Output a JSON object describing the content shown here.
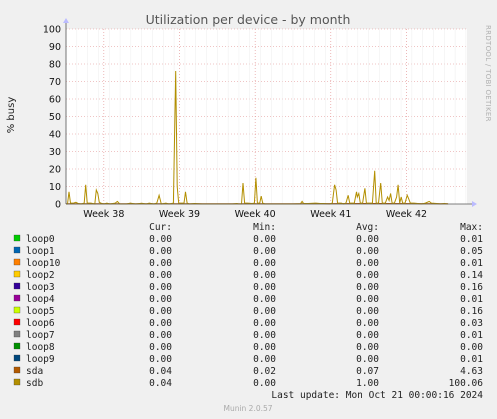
{
  "side_label": "RRDTOOL / TOBI OETIKER",
  "legend_headers": [
    "Cur:",
    "Min:",
    "Avg:",
    "Max:"
  ],
  "legend": [
    {
      "name": "loop0",
      "color": "#00cc00",
      "cur": "0.00",
      "min": "0.00",
      "avg": "0.00",
      "max": "0.01"
    },
    {
      "name": "loop1",
      "color": "#0066b3",
      "cur": "0.00",
      "min": "0.00",
      "avg": "0.00",
      "max": "0.05"
    },
    {
      "name": "loop10",
      "color": "#ff8000",
      "cur": "0.00",
      "min": "0.00",
      "avg": "0.00",
      "max": "0.01"
    },
    {
      "name": "loop2",
      "color": "#ffcc00",
      "cur": "0.00",
      "min": "0.00",
      "avg": "0.00",
      "max": "0.14"
    },
    {
      "name": "loop3",
      "color": "#330099",
      "cur": "0.00",
      "min": "0.00",
      "avg": "0.00",
      "max": "0.16"
    },
    {
      "name": "loop4",
      "color": "#990099",
      "cur": "0.00",
      "min": "0.00",
      "avg": "0.00",
      "max": "0.01"
    },
    {
      "name": "loop5",
      "color": "#ccff00",
      "cur": "0.00",
      "min": "0.00",
      "avg": "0.00",
      "max": "0.16"
    },
    {
      "name": "loop6",
      "color": "#ff0000",
      "cur": "0.00",
      "min": "0.00",
      "avg": "0.00",
      "max": "0.03"
    },
    {
      "name": "loop7",
      "color": "#808080",
      "cur": "0.00",
      "min": "0.00",
      "avg": "0.00",
      "max": "0.01"
    },
    {
      "name": "loop8",
      "color": "#008f00",
      "cur": "0.00",
      "min": "0.00",
      "avg": "0.00",
      "max": "0.00"
    },
    {
      "name": "loop9",
      "color": "#00487d",
      "cur": "0.00",
      "min": "0.00",
      "avg": "0.00",
      "max": "0.01"
    },
    {
      "name": "sda",
      "color": "#b35a00",
      "cur": "0.04",
      "min": "0.02",
      "avg": "0.07",
      "max": "4.63"
    },
    {
      "name": "sdb",
      "color": "#b38f00",
      "cur": "0.04",
      "min": "0.00",
      "avg": "1.00",
      "max": "100.06"
    }
  ],
  "last_update": "Last update:  Mon Oct 21 00:00:16 2024",
  "footer": "Munin 2.0.57",
  "chart_data": {
    "type": "line",
    "title": "Utilization per device - by month",
    "ylabel": "% busy",
    "xlabel": "",
    "ylim": [
      0,
      100
    ],
    "yticks": [
      0,
      10,
      20,
      30,
      40,
      50,
      60,
      70,
      80,
      90,
      100
    ],
    "xlim": [
      37.5,
      42.8
    ],
    "xticks": [
      {
        "label": "Week 38",
        "value": 38
      },
      {
        "label": "Week 39",
        "value": 39
      },
      {
        "label": "Week 40",
        "value": 40
      },
      {
        "label": "Week 41",
        "value": 41
      },
      {
        "label": "Week 42",
        "value": 42
      }
    ],
    "grid": true,
    "series": [
      {
        "name": "sdb",
        "color": "#b38f00",
        "points": [
          [
            37.5,
            0
          ],
          [
            37.52,
            0
          ],
          [
            37.54,
            7
          ],
          [
            37.56,
            0.5
          ],
          [
            37.6,
            0.5
          ],
          [
            37.63,
            1
          ],
          [
            37.66,
            0.3
          ],
          [
            37.7,
            0
          ],
          [
            37.74,
            0.5
          ],
          [
            37.76,
            11
          ],
          [
            37.78,
            0.5
          ],
          [
            37.83,
            0.5
          ],
          [
            37.88,
            0
          ],
          [
            37.9,
            8
          ],
          [
            37.92,
            6
          ],
          [
            37.94,
            1
          ],
          [
            37.96,
            0.5
          ],
          [
            38.0,
            0
          ],
          [
            38.04,
            0.5
          ],
          [
            38.08,
            0
          ],
          [
            38.15,
            0.5
          ],
          [
            38.18,
            1.5
          ],
          [
            38.21,
            0
          ],
          [
            38.3,
            0
          ],
          [
            38.35,
            0.5
          ],
          [
            38.42,
            0
          ],
          [
            38.5,
            0.4
          ],
          [
            38.56,
            0
          ],
          [
            38.6,
            0.5
          ],
          [
            38.66,
            0
          ],
          [
            38.7,
            0.5
          ],
          [
            38.73,
            5
          ],
          [
            38.76,
            0
          ],
          [
            38.82,
            0.5
          ],
          [
            38.86,
            0
          ],
          [
            38.92,
            0.5
          ],
          [
            38.95,
            76
          ],
          [
            38.97,
            10
          ],
          [
            38.99,
            0.5
          ],
          [
            39.02,
            0.5
          ],
          [
            39.06,
            0.5
          ],
          [
            39.08,
            7
          ],
          [
            39.1,
            0.5
          ],
          [
            39.13,
            0
          ],
          [
            39.2,
            0.3
          ],
          [
            39.3,
            0
          ],
          [
            39.5,
            0
          ],
          [
            39.7,
            0
          ],
          [
            39.76,
            0.3
          ],
          [
            39.78,
            0
          ],
          [
            39.82,
            0
          ],
          [
            39.84,
            12
          ],
          [
            39.86,
            0.5
          ],
          [
            39.9,
            0.5
          ],
          [
            39.96,
            0.3
          ],
          [
            39.99,
            0.5
          ],
          [
            40.01,
            15
          ],
          [
            40.03,
            0.5
          ],
          [
            40.06,
            0.5
          ],
          [
            40.08,
            4.5
          ],
          [
            40.1,
            0.5
          ],
          [
            40.13,
            0
          ],
          [
            40.3,
            0
          ],
          [
            40.5,
            0
          ],
          [
            40.6,
            0.2
          ],
          [
            40.62,
            1.5
          ],
          [
            40.64,
            0.3
          ],
          [
            40.7,
            0.3
          ],
          [
            40.8,
            0.5
          ],
          [
            40.86,
            0.3
          ],
          [
            40.9,
            0.3
          ],
          [
            40.98,
            0
          ],
          [
            41.02,
            0.5
          ],
          [
            41.05,
            11
          ],
          [
            41.07,
            8
          ],
          [
            41.09,
            0.5
          ],
          [
            41.14,
            0.5
          ],
          [
            41.17,
            0
          ],
          [
            41.2,
            0.5
          ],
          [
            41.23,
            5
          ],
          [
            41.25,
            0.5
          ],
          [
            41.28,
            0.5
          ],
          [
            41.31,
            0.5
          ],
          [
            41.34,
            7
          ],
          [
            41.35,
            4
          ],
          [
            41.37,
            6
          ],
          [
            41.39,
            0.5
          ],
          [
            41.42,
            0.5
          ],
          [
            41.45,
            9
          ],
          [
            41.47,
            0.5
          ],
          [
            41.52,
            0.5
          ],
          [
            41.55,
            0.5
          ],
          [
            41.58,
            19
          ],
          [
            41.6,
            0.5
          ],
          [
            41.63,
            0.5
          ],
          [
            41.66,
            12
          ],
          [
            41.68,
            0.5
          ],
          [
            41.72,
            0.5
          ],
          [
            41.75,
            4
          ],
          [
            41.77,
            2
          ],
          [
            41.79,
            6
          ],
          [
            41.81,
            0.5
          ],
          [
            41.84,
            0.5
          ],
          [
            41.87,
            4
          ],
          [
            41.89,
            11
          ],
          [
            41.91,
            0.5
          ],
          [
            41.93,
            4
          ],
          [
            41.95,
            0.5
          ],
          [
            41.98,
            0.5
          ],
          [
            42.01,
            5
          ],
          [
            42.03,
            3
          ],
          [
            42.05,
            0.5
          ],
          [
            42.1,
            0.5
          ],
          [
            42.15,
            0.3
          ],
          [
            42.2,
            0
          ],
          [
            42.25,
            0.5
          ],
          [
            42.3,
            1.5
          ],
          [
            42.33,
            0.5
          ],
          [
            42.4,
            0.3
          ],
          [
            42.45,
            0
          ],
          [
            42.5,
            0.3
          ],
          [
            42.55,
            0
          ]
        ]
      },
      {
        "name": "sda",
        "color": "#b35a00",
        "points": [
          [
            37.5,
            0.2
          ],
          [
            38.5,
            0.2
          ],
          [
            39.5,
            0.1
          ],
          [
            40.5,
            0.2
          ],
          [
            41.5,
            0.3
          ],
          [
            42.55,
            0.1
          ]
        ]
      }
    ]
  }
}
